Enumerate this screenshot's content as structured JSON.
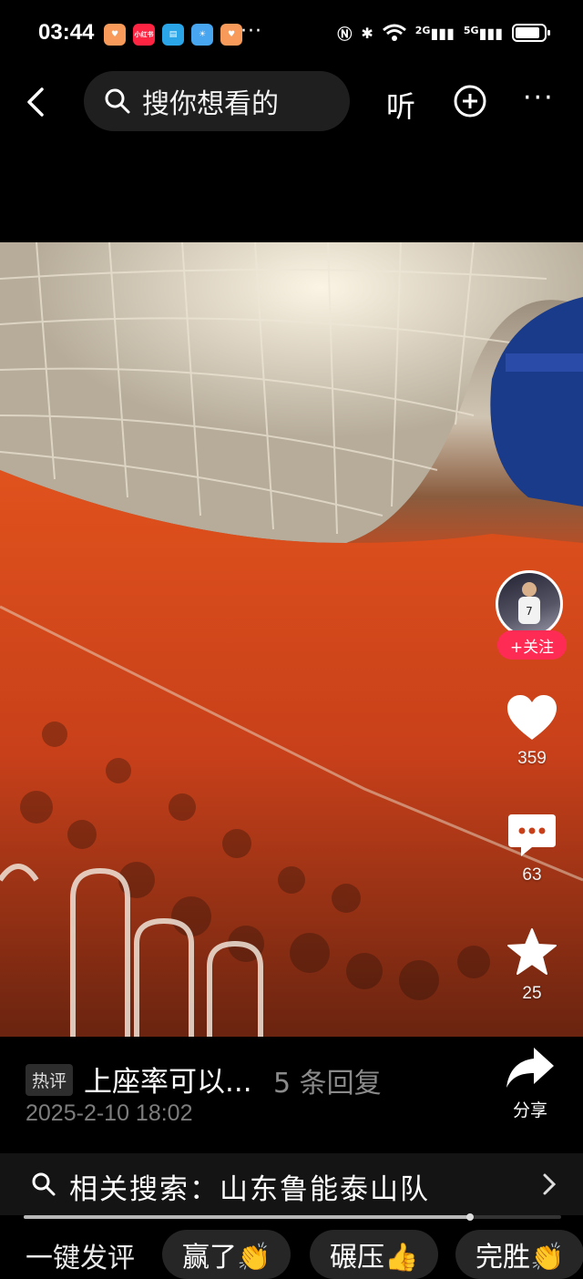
{
  "status_bar": {
    "time": "03:44",
    "app_icons": [
      {
        "name": "heart-app-icon",
        "label": "",
        "color": "#f79a5a"
      },
      {
        "name": "xiaohongshu-icon",
        "label": "小红书",
        "color": "#ff2442"
      },
      {
        "name": "book-app-icon",
        "label": "",
        "color": "#2aa6e8"
      },
      {
        "name": "weather-app-icon",
        "label": "",
        "color": "#48a6f0"
      },
      {
        "name": "heart-app-icon-2",
        "label": "",
        "color": "#f79a5a"
      }
    ],
    "more": "···",
    "network_2g": "2G",
    "network_5g": "5G"
  },
  "top_bar": {
    "search_placeholder": "搜你想看的",
    "listen_label": "听",
    "more_label": "···"
  },
  "video": {
    "description": "Stadium crowd in orange",
    "stadium_banner_color": "#1a3a8a"
  },
  "actions": {
    "follow_label": "+关注",
    "likes": "359",
    "comments": "63",
    "favorites": "25"
  },
  "comment": {
    "tag": "热评",
    "text": "上座率可以...",
    "replies": "5 条回复",
    "timestamp": "2025-2-10 18:02"
  },
  "share": {
    "label": "分享"
  },
  "related": {
    "text": "相关搜索：山东鲁能泰山队"
  },
  "progress": {
    "fraction": 0.83
  },
  "quick_comment": {
    "label": "一键发评",
    "chips": [
      "赢了👏",
      "碾压👍",
      "完胜👏"
    ]
  },
  "colors": {
    "accent": "#fe2c55",
    "background": "#000000"
  }
}
